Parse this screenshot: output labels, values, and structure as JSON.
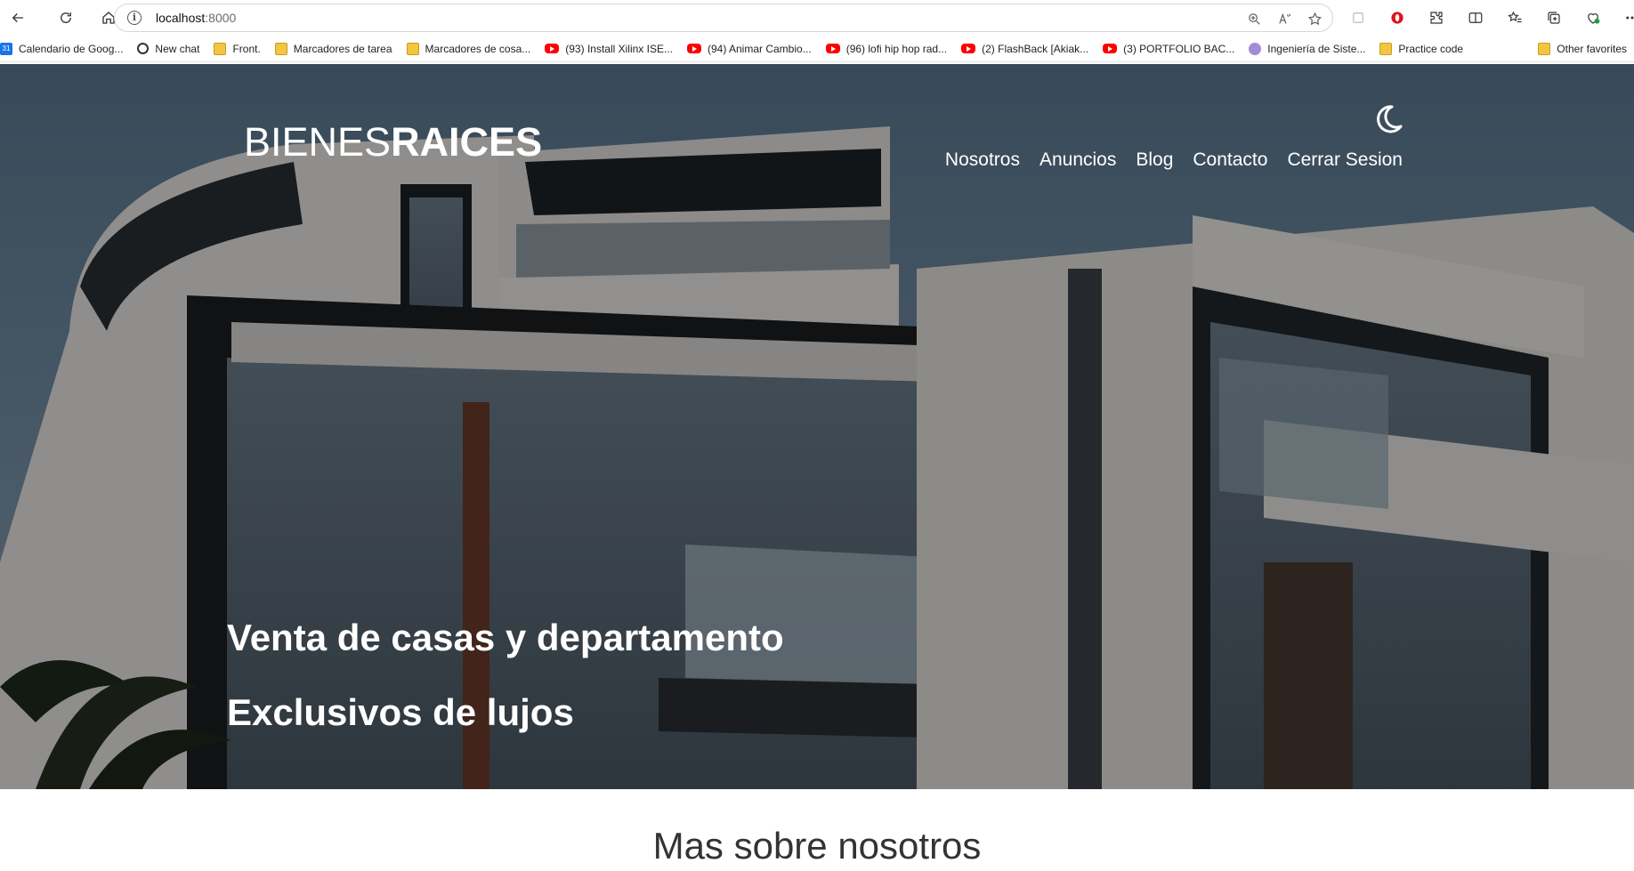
{
  "browser": {
    "url_host": "localhost",
    "url_port": ":8000",
    "bookmarks": [
      {
        "label": "Calendario de Goog...",
        "icon": "calendar-icon"
      },
      {
        "label": "New chat",
        "icon": "chat-icon"
      },
      {
        "label": "Front.",
        "icon": "folder-icon"
      },
      {
        "label": "Marcadores de tarea",
        "icon": "folder-icon"
      },
      {
        "label": "Marcadores de cosa...",
        "icon": "folder-icon"
      },
      {
        "label": "(93) Install Xilinx ISE...",
        "icon": "youtube-icon"
      },
      {
        "label": "(94) Animar Cambio...",
        "icon": "youtube-icon"
      },
      {
        "label": "(96) lofi hip hop rad...",
        "icon": "youtube-icon"
      },
      {
        "label": "(2) FlashBack [Akiak...",
        "icon": "youtube-icon"
      },
      {
        "label": "(3) PORTFOLIO BAC...",
        "icon": "youtube-icon"
      },
      {
        "label": "Ingeniería de Siste...",
        "icon": "university-icon"
      },
      {
        "label": "Practice code",
        "icon": "folder-icon"
      }
    ],
    "other_favorites": "Other favorites"
  },
  "site": {
    "logo_light": "BIENES",
    "logo_bold": "RAICES",
    "nav": [
      "Nosotros",
      "Anuncios",
      "Blog",
      "Contacto",
      "Cerrar Sesion"
    ],
    "hero_line1": "Venta de casas y departamento",
    "hero_line2": "Exclusivos de lujos",
    "section_title": "Mas sobre nosotros"
  },
  "colors": {
    "hero_overlay": "#000000",
    "text_on_hero": "#ffffff",
    "youtube_red": "#ff0000",
    "folder_yellow": "#f5c542"
  }
}
